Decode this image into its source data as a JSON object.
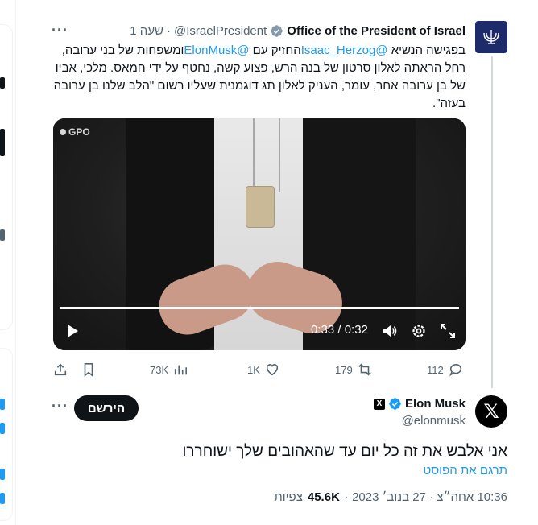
{
  "parent_tweet": {
    "display_name": "Office of the President of Israel",
    "handle": "@IsraelPresident",
    "separator": "·",
    "time": "שעה 1",
    "text_parts": {
      "p1": "בפגישה הנשיא ",
      "mention1": "@Isaac_Herzog",
      "p2": "החזיק עם ",
      "mention2": "@ElonMusk",
      "p3": "ומשפחות של בני ערובה, רחל הראתה לאלון סרטון של בנה הרש, פצוע קשה, נחטף על ידי חמאס.  מלכי, אביו של בן ערובה אחר, עומר, העניק לאלון תג דוגמנית שעליו רשום \"הלב שלנו בן ערובה בעזה\"."
    },
    "media": {
      "watermark": "GPO",
      "time_display": "0:33 / 0:32",
      "progress": 1.0
    },
    "actions": {
      "replies": "112",
      "retweets": "179",
      "likes": "1K",
      "views": "73K"
    }
  },
  "main_tweet": {
    "display_name": "Elon Musk",
    "handle": "@elonmusk",
    "follow_label": "הירשם",
    "text": "אני אלבש את זה כל יום עד שהאהובים שלך ישוחררו",
    "translate_label": "תרגם את הפוסט",
    "timestamp": "10:36 אחה״צ · 27 בנוב׳ 2023 ·",
    "views_count": "45.6K",
    "views_label": "צפיות"
  },
  "colors": {
    "link": "#1d9bf0",
    "secondary_text": "#536471",
    "primary_text": "#0f1419",
    "button_bg": "#0f1419"
  }
}
